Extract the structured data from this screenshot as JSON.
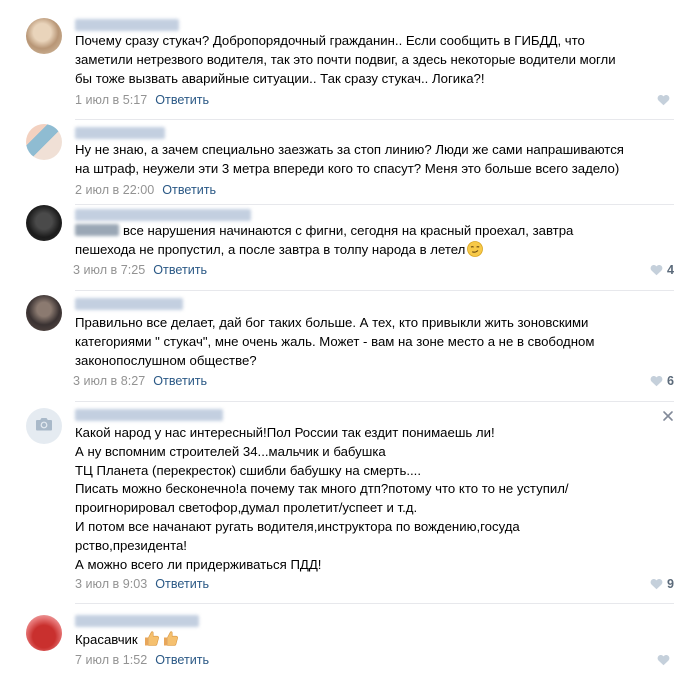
{
  "comments": [
    {
      "lines": [
        "Почему сразу стукач? Добропорядочный гражданин.. Если сообщить в ГИБДД, что",
        "заметили нетрезвого водителя, так это почти подвиг, а здесь некоторые водители могли",
        "бы тоже вызвать аварийные ситуации.. Так сразу стукач.. Логика?!"
      ],
      "time": "1 июл в 5:17",
      "reply": "Ответить",
      "likes": "",
      "avatar_colors": [
        "#d8c4a8",
        "#b89676",
        "#efe2cf"
      ]
    },
    {
      "lines": [
        "Ну не знаю, а зачем специально заезжать за стоп линию? Люди же сами напрашиваются",
        "на штраф, неужели эти 3 метра впереди кого то спасут? Меня это больше всего задело)"
      ],
      "time": "2 июл в 22:00",
      "reply": "Ответить",
      "likes": "",
      "avatar_colors": [
        "#f0c7b3",
        "#86b3c9",
        "#e9e9e9"
      ]
    },
    {
      "lines": [
        "все нарушения начинаются с фигни, сегодня на красный проехал, завтра",
        "пешехода не пропустил, а после завтра в толпу народа в летел"
      ],
      "time": "3 июл в 7:25",
      "reply": "Ответить",
      "likes": "4",
      "avatar_colors": [
        "#1c1c1c",
        "#3d3d3d",
        "#6a6a6a"
      ]
    },
    {
      "lines": [
        "Правильно все делает, дай бог таких больше. А тех, кто привыкли жить зоновскими",
        "категориями \" стукач\", мне очень жаль. Может - вам на зоне место а не в свободном",
        "законопослушном обществе?"
      ],
      "time": "3 июл в 8:27",
      "reply": "Ответить",
      "likes": "6",
      "avatar_colors": [
        "#2f2a2a",
        "#8b7a70",
        "#5c4e48"
      ]
    },
    {
      "lines": [
        "Какой народ у нас интересный!Пол России так ездит понимаешь ли!",
        "А ну вспомним строителей 34...мальчик и бабушка",
        "ТЦ Планета (перекресток) сшибли бабушку на смерть....",
        "Писать можно бесконечно!а почему так много дтп?потому что кто то не уступил/",
        "проигнорировал светофор,думал пролетит/успеет и т.д.",
        "И потом все начанают ругать водителя,инструктора по вождению,госуда",
        "рство,президента!",
        "А можно всего ли придерживаться ПДД!"
      ],
      "time": "3 июл в 9:03",
      "reply": "Ответить",
      "likes": "9",
      "avatar_colors": [
        "#e5ebf1",
        "#a9b9c9",
        "#e5ebf1"
      ]
    },
    {
      "lines": [
        "Красавчик"
      ],
      "time": "7 июл в 1:52",
      "reply": "Ответить",
      "likes": "",
      "avatar_colors": [
        "#c9302e",
        "#e57373",
        "#f2d0d0"
      ]
    }
  ],
  "icons": {
    "like": "heart-icon",
    "close": "close-icon",
    "camera": "camera-icon",
    "smirk_emoji": "smirking-face-emoji",
    "thumbs_up_emoji": "thumbs-up-emoji"
  },
  "colors": {
    "link": "#2a5885",
    "meta": "#939393",
    "like": "#c5d0db",
    "separator": "#e7e8ec"
  }
}
